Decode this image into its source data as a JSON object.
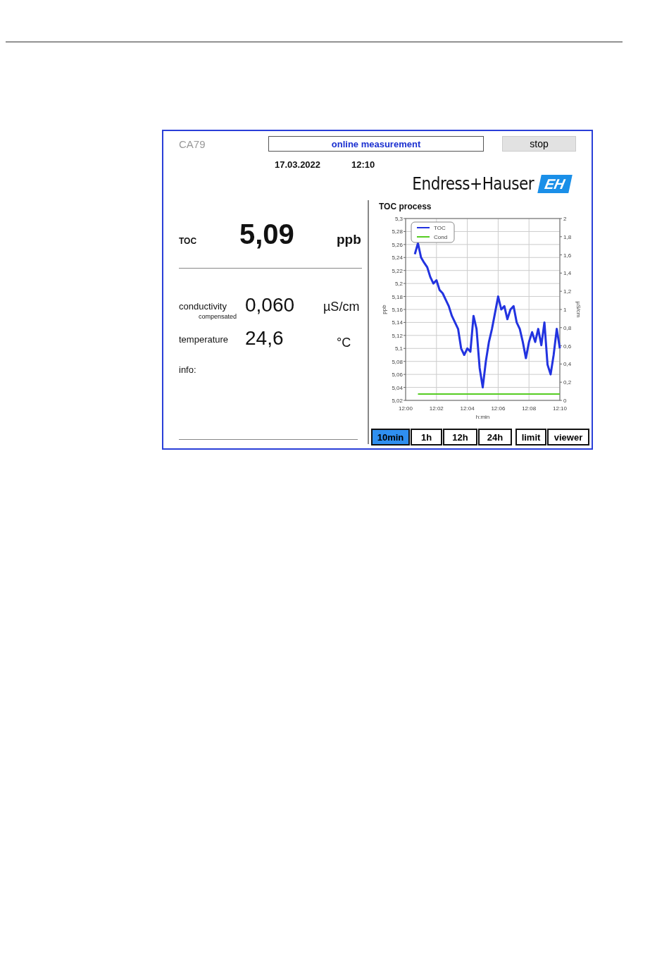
{
  "device": "CA79",
  "status_field": {
    "value": "online measurement"
  },
  "stop_button": "stop",
  "date": "17.03.2022",
  "time": "12:10",
  "logo": {
    "name": "Endress+Hauser",
    "mark": "EH"
  },
  "toc": {
    "label": "TOC",
    "value": "5,09",
    "unit": "ppb"
  },
  "readings": [
    {
      "label": "conductivity",
      "sublabel": "compensated",
      "value": "0,060",
      "unit": "µS/cm"
    },
    {
      "label": "temperature",
      "value": "24,6",
      "unit": "°C"
    }
  ],
  "info": {
    "label": "info:"
  },
  "chart": {
    "title": "TOC process",
    "chart_data": {
      "type": "line",
      "xlabel": "h:min",
      "ylabel": "ppb",
      "y2label": "µS/cm",
      "grid": true,
      "legend": "upper left",
      "ylim": [
        5.02,
        5.3
      ],
      "y2lim": [
        0,
        2
      ],
      "categories": [
        "12:00",
        null,
        null,
        null,
        null,
        null,
        null,
        null,
        null,
        null,
        "12:02",
        null,
        null,
        null,
        null,
        null,
        null,
        null,
        null,
        null,
        "12:04",
        null,
        null,
        null,
        null,
        null,
        null,
        null,
        null,
        null,
        "12:06",
        null,
        null,
        null,
        null,
        null,
        null,
        null,
        null,
        null,
        "12:08",
        null,
        null,
        null,
        null,
        null,
        null,
        null,
        null,
        null,
        "12:10"
      ],
      "yticks": [
        {
          "value": 5.3,
          "label": "5,3"
        },
        {
          "value": 5.28,
          "label": "5,28"
        },
        {
          "value": 5.26,
          "label": "5,26"
        },
        {
          "value": 5.24,
          "label": "5,24"
        },
        {
          "value": 5.22,
          "label": "5,22"
        },
        {
          "value": 5.2,
          "label": "5,2"
        },
        {
          "value": 5.18,
          "label": "5,18"
        },
        {
          "value": 5.16,
          "label": "5,16"
        },
        {
          "value": 5.14,
          "label": "5,14"
        },
        {
          "value": 5.12,
          "label": "5,12"
        },
        {
          "value": 5.1,
          "label": "5,1"
        },
        {
          "value": 5.08,
          "label": "5,08"
        },
        {
          "value": 5.06,
          "label": "5,06"
        },
        {
          "value": 5.04,
          "label": "5,04"
        },
        {
          "value": 5.02,
          "label": "5,02"
        }
      ],
      "y2ticks": [
        {
          "value": 2,
          "label": "2"
        },
        {
          "value": 1.8,
          "label": "1,8"
        },
        {
          "value": 1.6,
          "label": "1,6"
        },
        {
          "value": 1.4,
          "label": "1,4"
        },
        {
          "value": 1.2,
          "label": "1,2"
        },
        {
          "value": 1,
          "label": "1"
        },
        {
          "value": 0.8,
          "label": "0,8"
        },
        {
          "value": 0.6,
          "label": "0,6"
        },
        {
          "value": 0.4,
          "label": "0,4"
        },
        {
          "value": 0.2,
          "label": "0,2"
        },
        {
          "value": 0,
          "label": "0"
        }
      ],
      "series": [
        {
          "name": "TOC",
          "color": "#2233e0",
          "values": [
            null,
            null,
            null,
            5.245,
            5.262,
            5.24,
            5.232,
            5.225,
            5.21,
            5.2,
            5.205,
            5.19,
            5.185,
            5.175,
            5.165,
            5.15,
            5.14,
            5.13,
            5.1,
            5.09,
            5.1,
            5.095,
            5.15,
            5.13,
            5.07,
            5.04,
            5.08,
            5.11,
            5.13,
            5.155,
            5.18,
            5.16,
            5.165,
            5.145,
            5.16,
            5.165,
            5.14,
            5.13,
            5.11,
            5.085,
            5.11,
            5.125,
            5.11,
            5.13,
            5.105,
            5.14,
            5.075,
            5.06,
            5.09,
            5.13,
            5.1
          ]
        },
        {
          "name": "Cond",
          "color": "#55cc22",
          "axis": "y2",
          "values": [
            null,
            null,
            null,
            null,
            0.07,
            0.07,
            0.07,
            0.07,
            0.07,
            0.07,
            0.07,
            0.07,
            0.07,
            0.07,
            0.07,
            0.07,
            0.07,
            0.07,
            0.07,
            0.07,
            0.07,
            0.07,
            0.07,
            0.07,
            0.07,
            0.07,
            0.07,
            0.07,
            0.07,
            0.07,
            0.07,
            0.07,
            0.07,
            0.07,
            0.07,
            0.07,
            0.07,
            0.07,
            0.07,
            0.07,
            0.07,
            0.07,
            0.07,
            0.07,
            0.07,
            0.07,
            0.07,
            0.07,
            0.07,
            0.07,
            0.07
          ]
        }
      ]
    }
  },
  "range_tabs": [
    {
      "label": "10min",
      "selected": true
    },
    {
      "label": "1h",
      "selected": false
    },
    {
      "label": "12h",
      "selected": false
    },
    {
      "label": "24h",
      "selected": false
    }
  ],
  "buttons": [
    "limit",
    "viewer"
  ]
}
